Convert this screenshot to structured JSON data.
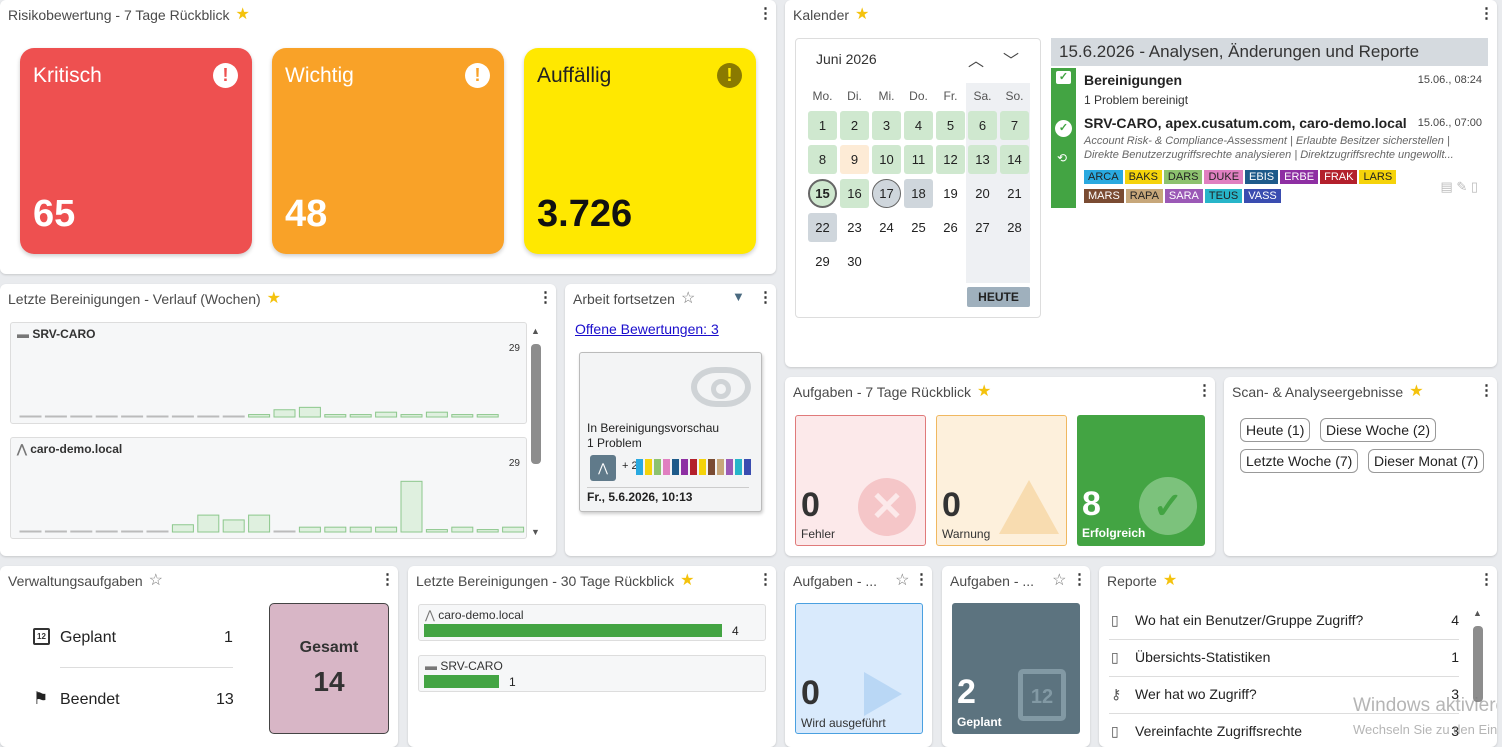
{
  "risk": {
    "title": "Risikobewertung - 7 Tage Rückblick",
    "cards": [
      {
        "label": "Kritisch",
        "value": "65",
        "color": "#ee5050"
      },
      {
        "label": "Wichtig",
        "value": "48",
        "color": "#f9a228"
      },
      {
        "label": "Auffällig",
        "value": "3.726",
        "color": "#ffe800"
      }
    ]
  },
  "calendar": {
    "title": "Kalender",
    "month": "Juni 2026",
    "weekdays": [
      "Mo.",
      "Di.",
      "Mi.",
      "Do.",
      "Fr.",
      "Sa.",
      "So."
    ],
    "days": [
      "1",
      "2",
      "3",
      "4",
      "5",
      "6",
      "7",
      "8",
      "9",
      "10",
      "11",
      "12",
      "13",
      "14",
      "15",
      "16",
      "17",
      "18",
      "19",
      "20",
      "21",
      "22",
      "23",
      "24",
      "25",
      "26",
      "27",
      "28",
      "29",
      "30"
    ],
    "today_label": "HEUTE",
    "detail": {
      "header": "15.6.2026 - Analysen, Änderungen und Reporte",
      "entries": [
        {
          "title": "Bereinigungen",
          "time": "15.06., 08:24",
          "text": "1 Problem bereinigt"
        },
        {
          "title": "SRV-CARO, apex.cusatum.com, caro-demo.local",
          "time": "15.06., 07:00",
          "text1": "Account Risk- & Compliance-Assessment | Erlaubte Besitzer sicherstellen |",
          "text2": "Direkte Benutzerzugriffsrechte analysieren | Direktzugriffsrechte ungewollt..."
        }
      ],
      "tags": [
        {
          "name": "ARCA",
          "color": "#29a9e0"
        },
        {
          "name": "BAKS",
          "color": "#f5d30a"
        },
        {
          "name": "DARS",
          "color": "#8dc26f"
        },
        {
          "name": "DUKE",
          "color": "#e07fc0"
        },
        {
          "name": "EBIS",
          "color": "#1e5b8a"
        },
        {
          "name": "ERBE",
          "color": "#8e2fa3"
        },
        {
          "name": "FRAK",
          "color": "#b3202c"
        },
        {
          "name": "LARS",
          "color": "#f5d30a"
        },
        {
          "name": "MARS",
          "color": "#7a4b32"
        },
        {
          "name": "RAPA",
          "color": "#c7a77a"
        },
        {
          "name": "SARA",
          "color": "#9b59b6"
        },
        {
          "name": "TEUS",
          "color": "#27b5c9"
        },
        {
          "name": "VASS",
          "color": "#3a4db0"
        }
      ]
    }
  },
  "history": {
    "title": "Letzte Bereinigungen - Verlauf (Wochen)",
    "panels": [
      {
        "name": "SRV-CARO",
        "max": "29",
        "values": [
          0,
          0,
          0,
          0,
          0,
          0,
          0,
          0,
          0,
          1,
          3,
          4,
          1,
          1,
          2,
          1,
          2,
          1,
          1
        ]
      },
      {
        "name": "caro-demo.local",
        "max": "29",
        "values": [
          0,
          0,
          0,
          0,
          0,
          0,
          3,
          7,
          5,
          7,
          0,
          2,
          2,
          2,
          2,
          21,
          1,
          2,
          1,
          2
        ]
      }
    ]
  },
  "continue": {
    "title": "Arbeit fortsetzen",
    "link_label": "Offene Bewertungen:",
    "link_count": "3",
    "card_line1": "In Bereinigungsvorschau",
    "card_line2": "1 Problem",
    "card_plus": "+ 2",
    "card_date": "Fr., 5.6.2026, 10:13"
  },
  "tasks7": {
    "title": "Aufgaben - 7 Tage Rückblick",
    "tiles": [
      {
        "value": "0",
        "label": "Fehler"
      },
      {
        "value": "0",
        "label": "Warnung"
      },
      {
        "value": "8",
        "label": "Erfolgreich"
      }
    ]
  },
  "scan": {
    "title": "Scan- & Analyseergebnisse",
    "chips": [
      "Heute (1)",
      "Diese Woche (2)",
      "Letzte Woche (7)",
      "Dieser Monat (7)"
    ]
  },
  "admin": {
    "title": "Verwaltungsaufgaben",
    "rows": [
      {
        "label": "Geplant",
        "value": "1"
      },
      {
        "label": "Beendet",
        "value": "13"
      }
    ],
    "total_label": "Gesamt",
    "total_value": "14"
  },
  "cleanup30": {
    "title": "Letzte Bereinigungen - 30 Tage Rückblick",
    "items": [
      {
        "name": "caro-demo.local",
        "value": 4
      },
      {
        "name": "SRV-CARO",
        "value": 1
      }
    ]
  },
  "tasksA": {
    "title": "Aufgaben - ...",
    "value": "0",
    "label": "Wird ausgeführt"
  },
  "tasksB": {
    "title": "Aufgaben - ...",
    "value": "2",
    "label": "Geplant"
  },
  "reports": {
    "title": "Reporte",
    "items": [
      {
        "label": "Wo hat ein Benutzer/Gruppe Zugriff?",
        "count": "4"
      },
      {
        "label": "Übersichts-Statistiken",
        "count": "1"
      },
      {
        "label": "Wer hat wo Zugriff?",
        "count": "3"
      },
      {
        "label": "Vereinfachte Zugriffsrechte",
        "count": "3"
      }
    ]
  },
  "watermark": {
    "line1": "Windows aktivieren",
    "line2": "Wechseln Sie zu den Einstellungen"
  }
}
